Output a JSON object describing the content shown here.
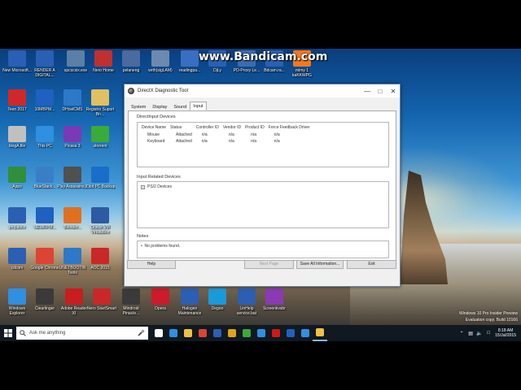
{
  "watermark": "www.Bandicam.com",
  "desktop_icons": [
    {
      "label": "New Microsoft...",
      "color": "#2b5fb3"
    },
    {
      "label": "RENDER A DIGITAL...",
      "color": "#2b5fb3"
    },
    {
      "label": "spcscsix.exe",
      "color": "#5b7fa6"
    },
    {
      "label": "Nero Home",
      "color": "#c03030"
    },
    {
      "label": "pelaneng",
      "color": "#4a6aa0"
    },
    {
      "label": "wrth(sigLAM)",
      "color": "#6c8ab0"
    },
    {
      "label": "readingpa...",
      "color": "#3a6ec0"
    },
    {
      "label": "DjLy",
      "color": "#2b5fb3"
    },
    {
      "label": "PD-Proxy Le...",
      "color": "#3c6cb0"
    },
    {
      "label": "Bdcam.ra...",
      "color": "#2b5fb3"
    },
    {
      "label": "mimy 1 kaKKWPG",
      "color": "#f07a20"
    },
    {
      "label": "Teen 2017",
      "color": "#d02828"
    },
    {
      "label": "10MBPM...",
      "color": "#2060c0"
    },
    {
      "label": "DHostCMS",
      "color": "#2d78c8"
    },
    {
      "label": "Registro Suport Bn...",
      "color": "#e0c060"
    },
    {
      "label": "blogA.file",
      "color": "#c0c0c0"
    },
    {
      "label": "This PC",
      "color": "#2f8fe0"
    },
    {
      "label": "Picasa 3",
      "color": "#7a3ab5"
    },
    {
      "label": "utorrent",
      "color": "#3aaa3a"
    },
    {
      "label": "Apps",
      "color": "#2f8f3a"
    },
    {
      "label": "BlueStack...",
      "color": "#3a7ec8"
    },
    {
      "label": "Play Assassins...",
      "color": "#505050"
    },
    {
      "label": "IObit PC Backup",
      "color": "#1a6ec8"
    },
    {
      "label": "proj.docx",
      "color": "#2b5fb3"
    },
    {
      "label": "NEWRPM...",
      "color": "#2060c0"
    },
    {
      "label": "Blender...",
      "color": "#e07020"
    },
    {
      "label": "Oracle VM VirtualBox",
      "color": "#2d5aa0"
    },
    {
      "label": "cdcom",
      "color": "#2b5fb3"
    },
    {
      "label": "Google Chrome",
      "color": "#dd4433"
    },
    {
      "label": "UNETBOOTIN Tools",
      "color": "#2d78c8"
    },
    {
      "label": "AOC 2015",
      "color": "#c82828"
    },
    {
      "label": "Windows Explorer",
      "color": "#2f8fe0"
    },
    {
      "label": "Clearlinger",
      "color": "#3a3a3a"
    },
    {
      "label": "Adobe Reader XI",
      "color": "#c81e1e"
    },
    {
      "label": "Nero StartSmart",
      "color": "#c82828"
    },
    {
      "label": "Mindroid Pinacle...",
      "color": "#3a3a3a"
    },
    {
      "label": "Opera",
      "color": "#cc1b2a"
    },
    {
      "label": "Halogen Maintenance",
      "color": "#2b5fb3"
    },
    {
      "label": "Degoo",
      "color": "#1a9ad8"
    },
    {
      "label": "LinHelp service.bat",
      "color": "#2b5fb3"
    },
    {
      "label": "Screenkvsbr",
      "color": "#8a3ab5"
    }
  ],
  "dx_window": {
    "title": "DirectX Diagnostic Tool",
    "controls": {
      "minimize": "—",
      "maximize": "□",
      "close": "✕"
    },
    "tabs": [
      "System",
      "Display",
      "Sound",
      "Input"
    ],
    "active_tab": "Input",
    "directinput": {
      "label": "DirectInput Devices",
      "columns": [
        "Device Name",
        "Status",
        "Controller ID",
        "Vendor ID",
        "Product ID",
        "Force Feedback Driver"
      ],
      "rows": [
        [
          "Mouse",
          "Attached",
          "n/a",
          "n/a",
          "n/a",
          "n/a"
        ],
        [
          "Keyboard",
          "Attached",
          "n/a",
          "n/a",
          "n/a",
          "n/a"
        ]
      ]
    },
    "input_related": {
      "label": "Input Related Devices",
      "items": [
        "PS/2 Devices"
      ]
    },
    "notes": {
      "label": "Notes",
      "items": [
        "No problems found."
      ]
    },
    "buttons": {
      "help": "Help",
      "next_page": "Next Page",
      "save_all": "Save All Information...",
      "exit": "Exit"
    }
  },
  "windows_watermark": {
    "line1": "Windows 10 Pro Insider Preview",
    "line2": "Evaluation copy. Build 10166"
  },
  "taskbar": {
    "search_placeholder": "Ask me anything",
    "apps": [
      {
        "name": "task-view",
        "color": "#ffffff"
      },
      {
        "name": "edge",
        "color": "#2f8fe0"
      },
      {
        "name": "file-explorer",
        "color": "#f0c040"
      },
      {
        "name": "chrome",
        "color": "#dd4433"
      },
      {
        "name": "store",
        "color": "#2b5fb3"
      },
      {
        "name": "media",
        "color": "#e0a020"
      },
      {
        "name": "utorrent",
        "color": "#3aaa3a"
      },
      {
        "name": "photos",
        "color": "#2f8fe0"
      },
      {
        "name": "bandicam",
        "color": "#d01818"
      },
      {
        "name": "settings",
        "color": "#2060c0"
      },
      {
        "name": "app",
        "color": "#2f8fe0"
      },
      {
        "name": "dxdiag",
        "color": "#f0c040"
      }
    ],
    "active_app": "dxdiag",
    "time": "8:18 AM",
    "date": "15/Jul/2015"
  }
}
